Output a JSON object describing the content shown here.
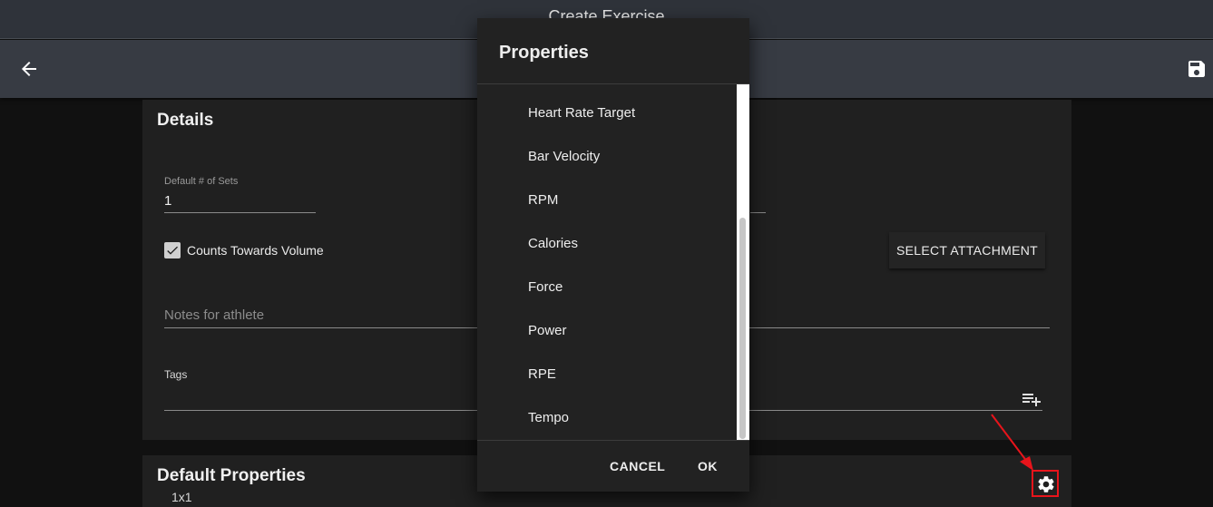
{
  "window": {
    "title": "Create Exercise"
  },
  "details": {
    "title": "Details",
    "sets_label": "Default # of Sets",
    "sets_value": "1",
    "counts_label": "Counts Towards Volume",
    "counts_checked": true,
    "select_attachment": "SELECT ATTACHMENT",
    "notes_placeholder": "Notes for athlete",
    "tags_label": "Tags"
  },
  "default_properties": {
    "title": "Default Properties",
    "sub": "1x1"
  },
  "dialog": {
    "title": "Properties",
    "items": [
      "Heart Rate Target",
      "Bar Velocity",
      "RPM",
      "Calories",
      "Force",
      "Power",
      "RPE",
      "Tempo"
    ],
    "scroll_position": 0.62,
    "cancel": "CANCEL",
    "ok": "OK"
  },
  "icons": {
    "back": "arrow-back-icon",
    "save": "floppy-save-icon",
    "check": "check-icon",
    "playlist_add": "playlist-add-icon",
    "settings": "gear-icon"
  },
  "colors": {
    "highlight": "#e8141b",
    "appbar": "#373b43",
    "card": "#202020",
    "dialog": "#222222"
  }
}
